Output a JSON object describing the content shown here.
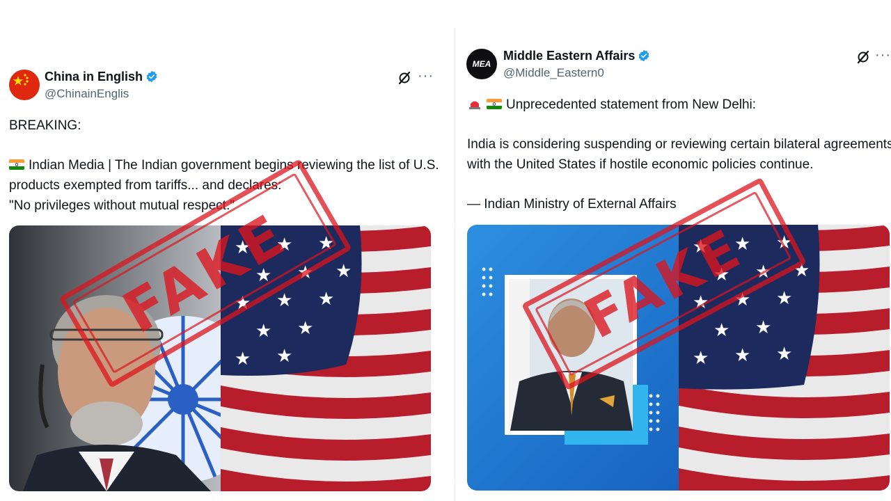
{
  "tweets": [
    {
      "display_name": "China in English",
      "handle": "@ChinainEnglis",
      "lines": [
        "BREAKING:",
        "Indian Media | The Indian government begins reviewing the list of U.S.",
        "products exempted from tariffs... and declares:",
        "\"No privileges without mutual respect.\""
      ],
      "more_label": "···",
      "stamp": "FAKE"
    },
    {
      "display_name": "Middle Eastern Affairs",
      "handle": "@Middle_Eastern0",
      "avatar_text": "MEA",
      "lines": [
        "Unprecedented statement from New Delhi:",
        "India is considering suspending or reviewing certain bilateral agreements",
        "with the United States if hostile economic policies continue.",
        "— Indian Ministry of External Affairs"
      ],
      "more_label": "···",
      "stamp": "FAKE"
    }
  ],
  "colors": {
    "verified": "#1d9bf0",
    "stamp_red": "#dc141e",
    "text": "#0f1419",
    "muted": "#536471"
  },
  "icons": [
    "verified-badge-icon",
    "grok-icon",
    "more-icon",
    "india-flag-icon",
    "siren-icon",
    "china-flag-icon"
  ]
}
